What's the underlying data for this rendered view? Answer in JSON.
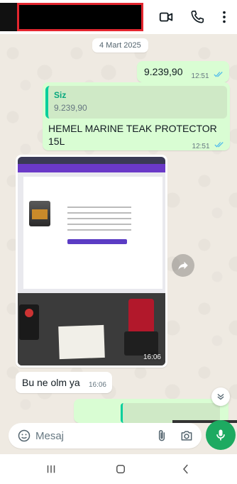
{
  "header": {
    "icons": [
      "video-call-icon",
      "voice-call-icon",
      "more-options-icon"
    ]
  },
  "chat": {
    "date": "4 Mart 2025",
    "messages": [
      {
        "type": "outgoing",
        "text": "9.239,90",
        "time": "12:51",
        "status": "read"
      },
      {
        "type": "outgoing-reply",
        "quote_author": "Siz",
        "quote_text": "9.239,90",
        "text": "HEMEL MARINE TEAK PROTECTOR 15L",
        "time": "12:51",
        "status": "read"
      },
      {
        "type": "incoming-photo",
        "time": "16:06"
      },
      {
        "type": "incoming",
        "text": "Bu ne olm ya",
        "time": "16:06"
      }
    ]
  },
  "composer": {
    "placeholder": "Mesaj"
  },
  "colors": {
    "outgoing_bubble": "#d9fdd3",
    "incoming_bubble": "#ffffff",
    "accent_green": "#1daa61",
    "read_ticks": "#53bdeb",
    "redaction_border": "#e3262f"
  }
}
